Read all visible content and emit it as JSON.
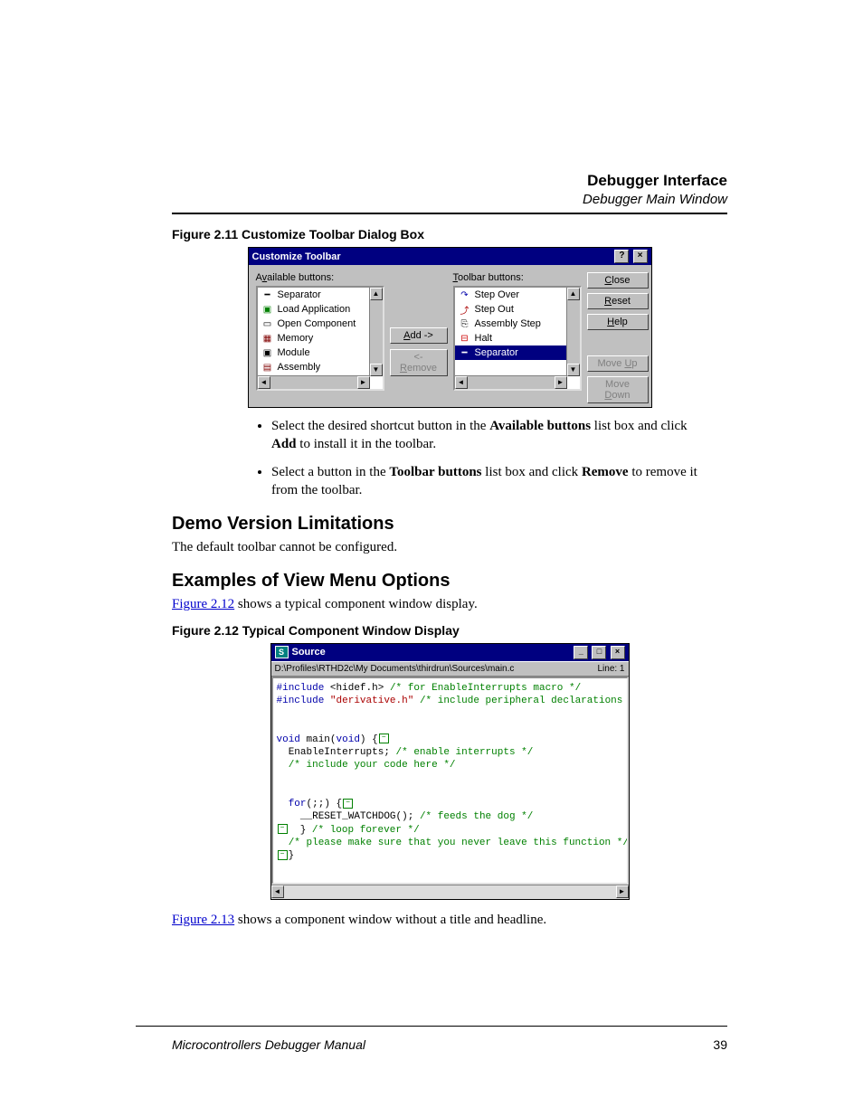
{
  "header": {
    "title": "Debugger Interface",
    "subtitle": "Debugger Main Window"
  },
  "fig1": {
    "caption": "Figure 2.11  Customize Toolbar Dialog Box",
    "dialog_title": "Customize Toolbar",
    "help_q": "?",
    "close_x": "×",
    "left_label_pre": "A",
    "left_label_mid": "v",
    "left_label_post": "ailable buttons:",
    "right_label_pre": "",
    "right_label_mid": "T",
    "right_label_post": "oolbar buttons:",
    "left_items": [
      "Separator",
      "Load Application",
      "Open Component",
      "Memory",
      "Module",
      "Assembly"
    ],
    "right_items": [
      "Step Over",
      "Step Out",
      "Assembly Step",
      "Halt",
      "Separator"
    ],
    "right_selected_index": 4,
    "add_pre": "",
    "add_u": "A",
    "add_post": "dd ->",
    "remove_pre": "<- ",
    "remove_u": "R",
    "remove_post": "emove",
    "close_u": "C",
    "close_post": "lose",
    "reset_u": "R",
    "reset_post": "eset",
    "help2_u": "H",
    "help2_post": "elp",
    "moveup_pre": "Move ",
    "moveup_u": "U",
    "moveup_post": "p",
    "movedn_pre": "Move ",
    "movedn_u": "D",
    "movedn_post": "own"
  },
  "bullets": {
    "b1_a": "Select the desired shortcut button in the ",
    "b1_b": "Available buttons",
    "b1_c": " list box and click ",
    "b1_d": "Add",
    "b1_e": " to install it in the toolbar.",
    "b2_a": "Select a button in the ",
    "b2_b": "Toolbar buttons",
    "b2_c": " list box and click ",
    "b2_d": "Remove",
    "b2_e": " to remove it from the toolbar."
  },
  "s1": {
    "h": "Demo Version Limitations",
    "p": "The default toolbar cannot be configured."
  },
  "s2": {
    "h": "Examples of View Menu Options",
    "link": "Figure 2.12",
    "rest": " shows a typical component window display."
  },
  "fig2": {
    "caption": "Figure 2.12  Typical Component Window Display",
    "title": "Source",
    "min": "_",
    "max": "□",
    "close": "×",
    "path": "D:\\Profiles\\RTHD2c\\My Documents\\thirdrun\\Sources\\main.c",
    "line": "Line: 1",
    "code": {
      "l1a": "#include ",
      "l1b": "<hidef.h>",
      "l1c": " /* for EnableInterrupts macro */",
      "l2a": "#include ",
      "l2b": "\"derivative.h\"",
      "l2c": " /* include peripheral declarations */",
      "l3a": "void",
      "l3b": " main(",
      "l3c": "void",
      "l3d": ") {",
      "l4a": "  EnableInterrupts; ",
      "l4b": "/* enable interrupts */",
      "l5": "  /* include your code here */",
      "l6a": "  for",
      "l6b": "(;;) {",
      "l7a": "    __RESET_WATCHDOG(); ",
      "l7b": "/* feeds the dog */",
      "l8a": "  } ",
      "l8b": "/* loop forever */",
      "l9": "  /* please make sure that you never leave this function */",
      "l10": "}"
    }
  },
  "after2": {
    "link": "Figure 2.13",
    "rest": " shows a component window without a title and headline."
  },
  "footer": {
    "left": "Microcontrollers Debugger Manual",
    "page": "39"
  }
}
